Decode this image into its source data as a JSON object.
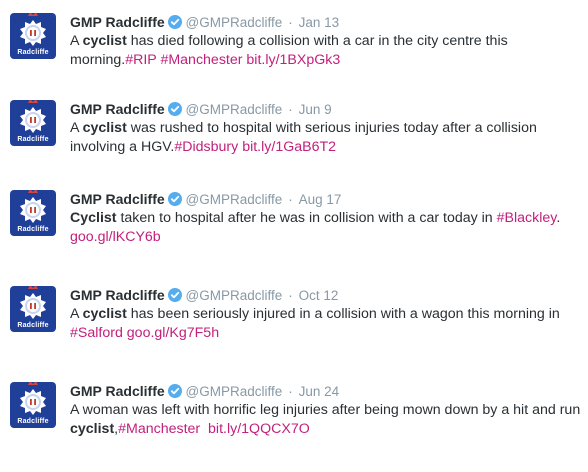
{
  "account": {
    "name": "GMP Radcliffe",
    "handle": "@GMPRadcliffe",
    "avatar_label": "Radcliffe",
    "avatar_icon": "gmp-crest-icon",
    "verified_icon": "verified-badge-icon",
    "separator": "·"
  },
  "colors": {
    "link": "#c2207c",
    "avatar_bg": "#1f3f99",
    "verified": "#55acee",
    "meta": "#8899a6"
  },
  "tweets": [
    {
      "date": "Jan 13",
      "parts": [
        {
          "t": "A "
        },
        {
          "t": "cyclist",
          "b": true
        },
        {
          "t": " has died following a collision with a car in the city centre this morning."
        },
        {
          "t": "#RIP",
          "hashtag": true
        },
        {
          "t": " "
        },
        {
          "t": "#Manchester",
          "hashtag": true
        },
        {
          "t": " "
        },
        {
          "t": "bit.ly/1BXpGk3",
          "link": true
        }
      ]
    },
    {
      "date": "Jun 9",
      "parts": [
        {
          "t": "A "
        },
        {
          "t": "cyclist",
          "b": true
        },
        {
          "t": " was rushed to hospital with serious injuries today after a collision involving a HGV."
        },
        {
          "t": "#Didsbury",
          "hashtag": true
        },
        {
          "t": " "
        },
        {
          "t": "bit.ly/1GaB6T2",
          "link": true
        }
      ]
    },
    {
      "date": "Aug 17",
      "parts": [
        {
          "t": "Cyclist",
          "b": true
        },
        {
          "t": " taken to hospital after he was in collision with a car today in "
        },
        {
          "t": "#Blackley",
          "hashtag": true
        },
        {
          "t": ". "
        },
        {
          "t": "goo.gl/lKCY6b",
          "link": true
        }
      ]
    },
    {
      "date": "Oct 12",
      "parts": [
        {
          "t": "A "
        },
        {
          "t": "cyclist",
          "b": true
        },
        {
          "t": " has been seriously injured in a collision with a wagon this morning in "
        },
        {
          "t": "#Salford",
          "hashtag": true
        },
        {
          "t": " "
        },
        {
          "t": "goo.gl/Kg7F5h",
          "link": true
        }
      ]
    },
    {
      "date": "Jun 24",
      "parts": [
        {
          "t": "A woman was left with horrific leg injuries after being mown down by a hit and run "
        },
        {
          "t": "cyclist",
          "b": true
        },
        {
          "t": ","
        },
        {
          "t": "#Manchester",
          "hashtag": true
        },
        {
          "t": "  "
        },
        {
          "t": "bit.ly/1QQCX7O",
          "link": true
        }
      ]
    }
  ]
}
